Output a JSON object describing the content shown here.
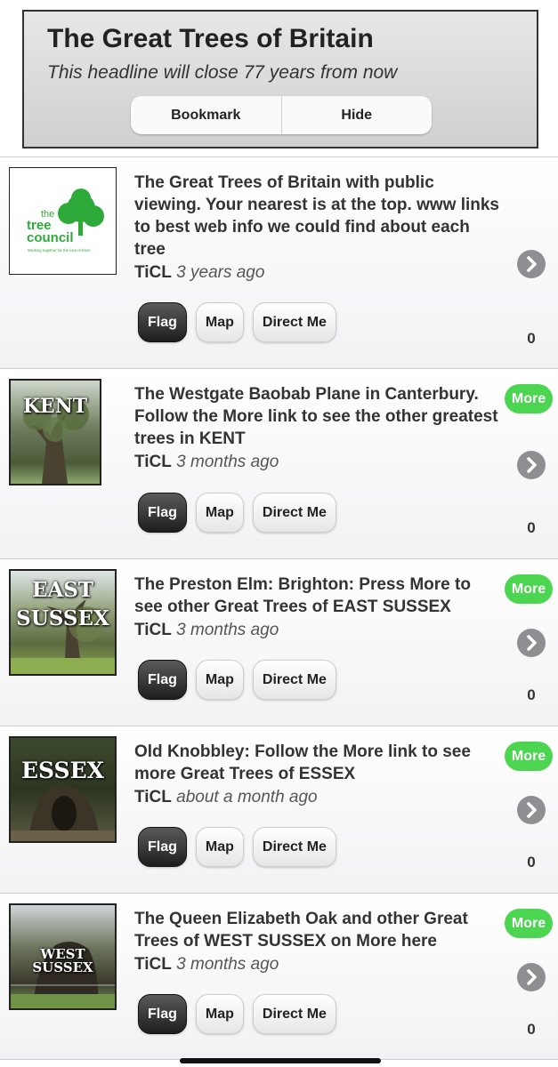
{
  "headline": {
    "title": "The Great Trees of Britain",
    "subtitle": "This headline will close 77 years from now",
    "bookmark_label": "Bookmark",
    "hide_label": "Hide"
  },
  "buttons": {
    "flag": "Flag",
    "map": "Map",
    "direct": "Direct Me",
    "more": "More"
  },
  "logo": {
    "line1": "the",
    "line2": "tree",
    "line3": "council",
    "tagline": "Working together for the love of trees"
  },
  "posts": [
    {
      "title": "The Great Trees of Britain with public viewing. Your nearest is at the top. www links to best web info we could find about each tree",
      "author": "TiCL",
      "time": "3 years ago",
      "count": "0",
      "thumb": "tree-council-logo"
    },
    {
      "title": "The Westgate Baobab Plane in Canterbury. Follow the More link to see the other greatest trees in KENT",
      "author": "TiCL",
      "time": "3 months ago",
      "count": "0",
      "county": "KENT"
    },
    {
      "title": "The Preston Elm: Brighton: Press More to see other Great Trees of EAST SUSSEX",
      "author": "TiCL",
      "time": "3 months ago",
      "count": "0",
      "county_line1": "EAST",
      "county_line2": "SUSSEX"
    },
    {
      "title": "Old Knobbley: Follow the More link to see more Great Trees of ESSEX",
      "author": "TiCL",
      "time": "about a month ago",
      "count": "0",
      "county": "ESSEX"
    },
    {
      "title": "The Queen Elizabeth Oak and other Great Trees of WEST SUSSEX on More here",
      "author": "TiCL",
      "time": "3 months ago",
      "count": "0",
      "county": "WEST SUSSEX"
    }
  ],
  "colors": {
    "more_green": "#4cd550",
    "dark_button": "#2a2a2a",
    "logo_green": "#2eaa3a"
  }
}
